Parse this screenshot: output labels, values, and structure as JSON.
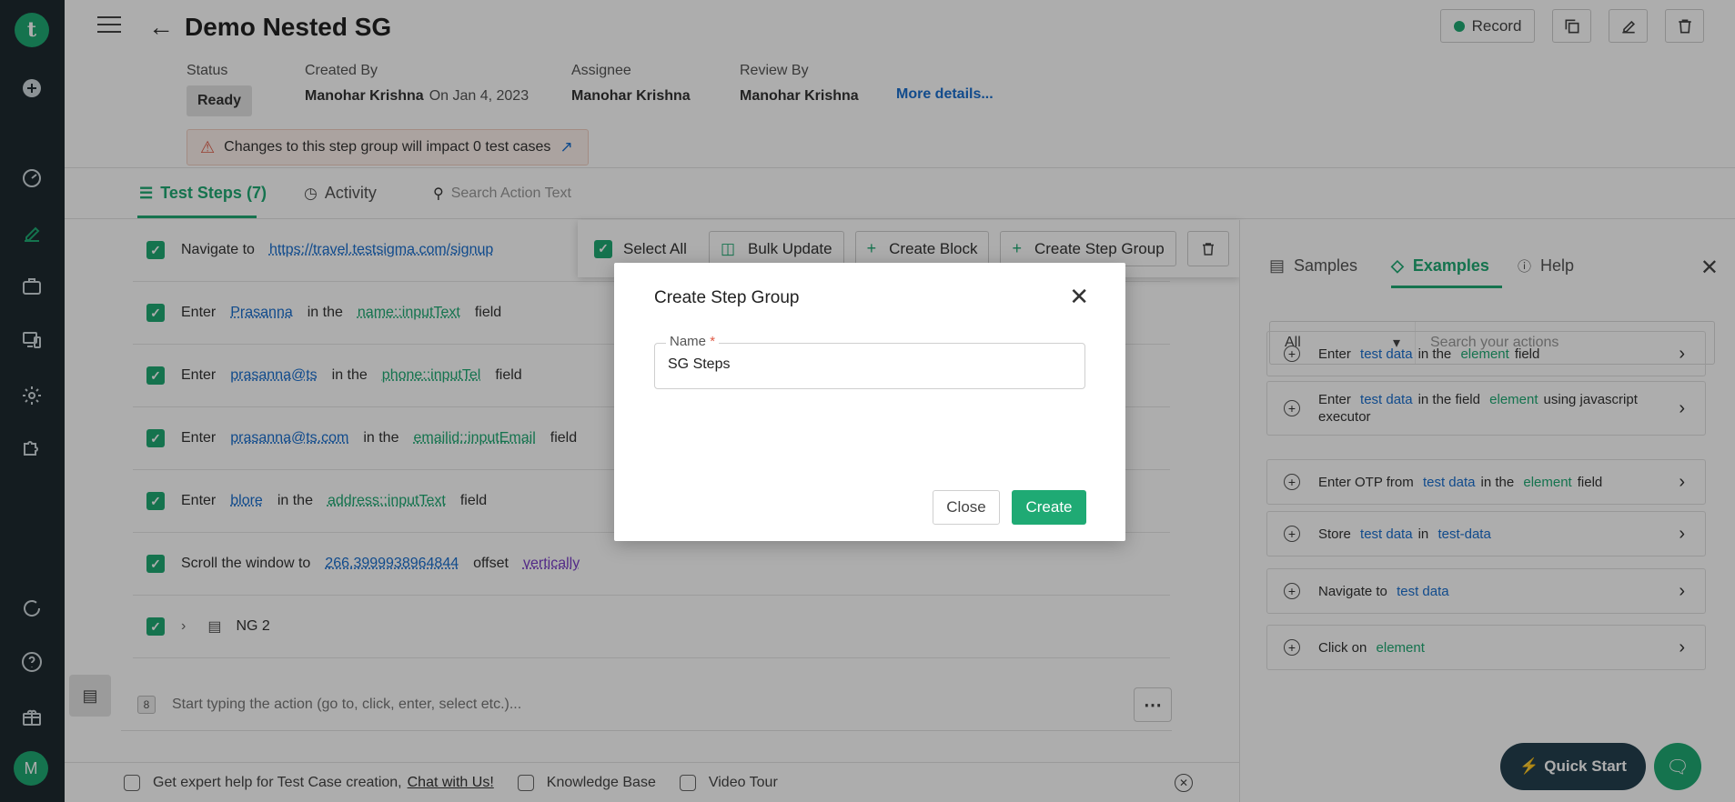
{
  "app": {
    "logo_letter": "t",
    "avatar_letter": "M",
    "accent": "#1faa74",
    "link": "#1a6fcf"
  },
  "header": {
    "title": "Demo Nested SG",
    "record_label": "Record"
  },
  "meta": {
    "status_label": "Status",
    "status_value": "Ready",
    "created_by_label": "Created By",
    "created_by_value": "Manohar Krishna",
    "created_on": "On Jan 4, 2023",
    "assignee_label": "Assignee",
    "assignee_value": "Manohar Krishna",
    "review_by_label": "Review By",
    "review_by_value": "Manohar Krishna",
    "more_details": "More details...",
    "warning": "Changes to this step group will impact 0 test cases"
  },
  "tabs": {
    "steps": "Test Steps (7)",
    "activity": "Activity",
    "search_placeholder": "Search Action Text"
  },
  "steps": [
    {
      "parts": [
        {
          "t": "Navigate to",
          "k": "plain"
        },
        {
          "t": "https://travel.testsigma.com/signup",
          "k": "data"
        }
      ]
    },
    {
      "parts": [
        {
          "t": "Enter",
          "k": "plain"
        },
        {
          "t": "Prasanna",
          "k": "data"
        },
        {
          "t": "in the",
          "k": "plain"
        },
        {
          "t": "name::inputText",
          "k": "el"
        },
        {
          "t": "field",
          "k": "plain"
        }
      ]
    },
    {
      "parts": [
        {
          "t": "Enter",
          "k": "plain"
        },
        {
          "t": "prasanna@ts",
          "k": "data"
        },
        {
          "t": "in the",
          "k": "plain"
        },
        {
          "t": "phone::inputTel",
          "k": "el"
        },
        {
          "t": "field",
          "k": "plain"
        }
      ]
    },
    {
      "parts": [
        {
          "t": "Enter",
          "k": "plain"
        },
        {
          "t": "prasanna@ts.com",
          "k": "data"
        },
        {
          "t": "in the",
          "k": "plain"
        },
        {
          "t": "emailid::inputEmail",
          "k": "el"
        },
        {
          "t": "field",
          "k": "plain"
        }
      ]
    },
    {
      "parts": [
        {
          "t": "Enter",
          "k": "plain"
        },
        {
          "t": "blore",
          "k": "data"
        },
        {
          "t": "in the",
          "k": "plain"
        },
        {
          "t": "address::inputText",
          "k": "el"
        },
        {
          "t": "field",
          "k": "plain"
        }
      ]
    },
    {
      "parts": [
        {
          "t": "Scroll the window to",
          "k": "plain"
        },
        {
          "t": "266.3999938964844",
          "k": "data"
        },
        {
          "t": "offset",
          "k": "plain"
        },
        {
          "t": "vertically",
          "k": "dir"
        }
      ]
    }
  ],
  "nested_group": {
    "label": "NG 2"
  },
  "new_step": {
    "number": "8",
    "placeholder": "Start typing the action (go to, click, enter, select etc.)..."
  },
  "bulk": {
    "select_all": "Select All",
    "bulk_update": "Bulk Update",
    "create_block": "Create Block",
    "create_step_group": "Create Step Group"
  },
  "right_panel": {
    "tab_samples": "Samples",
    "tab_examples": "Examples",
    "tab_help": "Help",
    "filter_value": "All",
    "search_placeholder": "Search your actions",
    "actions": [
      {
        "parts": [
          {
            "t": "Enter",
            "k": "plain"
          },
          {
            "t": "test data",
            "k": "data"
          },
          {
            "t": "in the",
            "k": "plain"
          },
          {
            "t": "element",
            "k": "el"
          },
          {
            "t": "field",
            "k": "plain"
          }
        ]
      },
      {
        "parts": [
          {
            "t": "Enter",
            "k": "plain"
          },
          {
            "t": "test data",
            "k": "data"
          },
          {
            "t": "in the field",
            "k": "plain"
          },
          {
            "t": "element",
            "k": "el"
          },
          {
            "t": "using javascript executor",
            "k": "plain"
          }
        ]
      },
      {
        "parts": [
          {
            "t": "Enter OTP from",
            "k": "plain"
          },
          {
            "t": "test data",
            "k": "data"
          },
          {
            "t": "in the",
            "k": "plain"
          },
          {
            "t": "element",
            "k": "el"
          },
          {
            "t": "field",
            "k": "plain"
          }
        ]
      },
      {
        "parts": [
          {
            "t": "Store",
            "k": "plain"
          },
          {
            "t": "test data",
            "k": "data"
          },
          {
            "t": "in",
            "k": "plain"
          },
          {
            "t": "test-data",
            "k": "data"
          }
        ]
      },
      {
        "parts": [
          {
            "t": "Navigate to",
            "k": "plain"
          },
          {
            "t": "test data",
            "k": "data"
          }
        ]
      },
      {
        "parts": [
          {
            "t": "Click on",
            "k": "plain"
          },
          {
            "t": "element",
            "k": "el"
          }
        ]
      }
    ]
  },
  "bottombar": {
    "help_text": "Get expert help for Test Case creation,",
    "chat_link": "Chat with Us!",
    "knowledge_base": "Knowledge Base",
    "video_tour": "Video Tour"
  },
  "quick_start": "Quick Start",
  "modal": {
    "title": "Create Step Group",
    "name_label": "Name",
    "required_mark": "*",
    "name_value": "SG Steps",
    "close_label": "Close",
    "create_label": "Create"
  }
}
